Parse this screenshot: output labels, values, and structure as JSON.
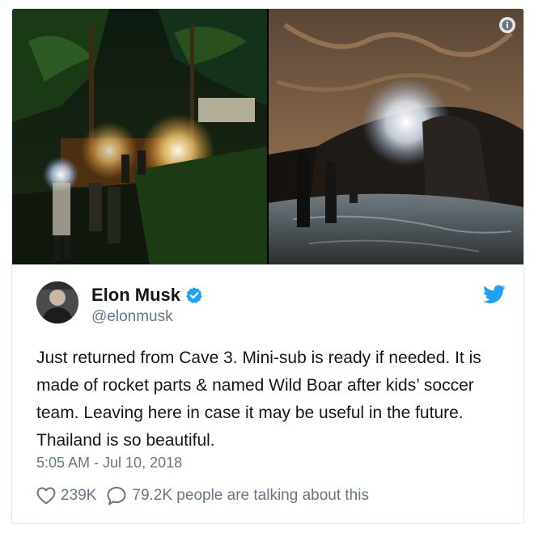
{
  "media": {
    "left_photo": "night-jungle-rescue-camp-photo",
    "right_photo": "cave-interior-rescuers-photo",
    "info_icon": "info-icon"
  },
  "author": {
    "name": "Elon Musk",
    "handle": "@elonmusk",
    "verified": true,
    "avatar": "avatar"
  },
  "tweet": {
    "text": "Just returned from Cave 3. Mini-sub is ready if needed. It is made of rocket parts & named Wild Boar after kids’ soccer team. Leaving here in case it may be useful in the future. Thailand is so beautiful.",
    "timestamp": "5:05 AM - Jul 10, 2018"
  },
  "engagement": {
    "likes": "239K",
    "talking": "79.2K people are talking about this"
  },
  "colors": {
    "brand_blue": "#1da1f2",
    "text": "#14171a",
    "secondary_text": "#657786",
    "border": "#e1e8ed"
  }
}
